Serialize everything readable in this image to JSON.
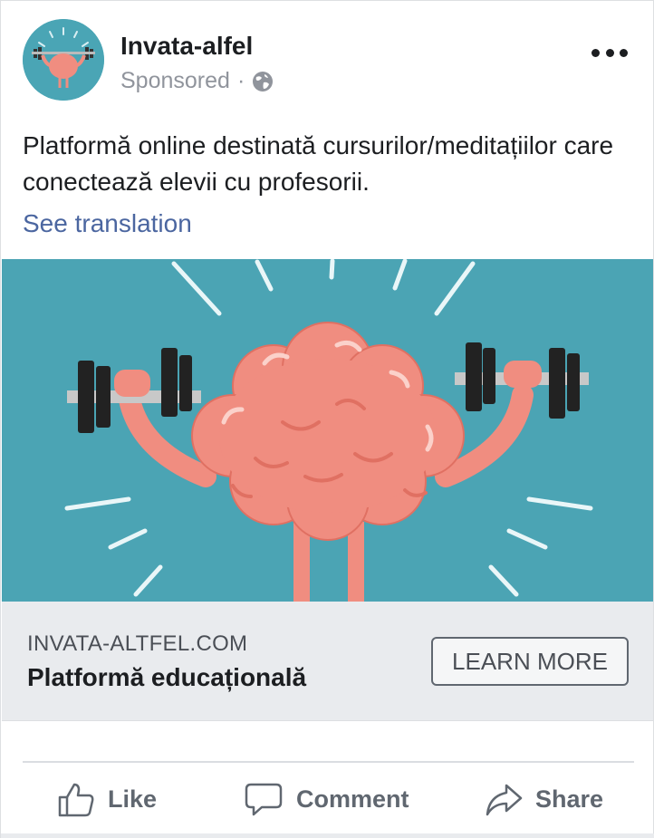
{
  "post": {
    "page_name": "Invata-alfel",
    "sponsored_label": "Sponsored",
    "separator": "·",
    "text": "Platformă online destinată cursurilor/meditațiilor care conectează elevii cu profesorii.",
    "see_translation": "See translation"
  },
  "link": {
    "domain": "INVATA-ALTFEL.COM",
    "headline": "Platformă educațională",
    "cta": "LEARN MORE"
  },
  "actions": {
    "like": "Like",
    "comment": "Comment",
    "share": "Share"
  },
  "colors": {
    "image_bg": "#4ba4b4",
    "brain": "#f08d80",
    "link_blue": "#4b66a0",
    "muted": "#90949c"
  },
  "icons": [
    "globe-icon",
    "more-options-icon",
    "like-icon",
    "comment-icon",
    "share-icon"
  ]
}
